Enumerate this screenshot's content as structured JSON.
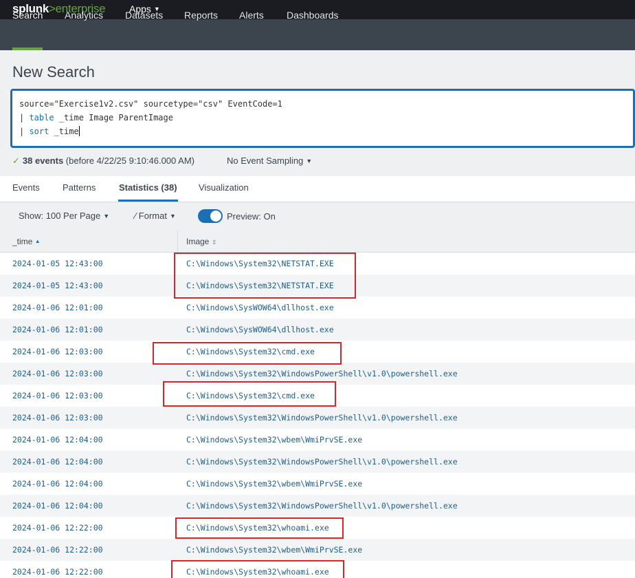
{
  "topbar": {
    "logo_word": "splunk",
    "logo_sep": ">",
    "logo_product": "enterprise",
    "apps_label": "Apps"
  },
  "nav": {
    "items": [
      {
        "label": "Search"
      },
      {
        "label": "Analytics"
      },
      {
        "label": "Datasets"
      },
      {
        "label": "Reports"
      },
      {
        "label": "Alerts"
      },
      {
        "label": "Dashboards"
      }
    ]
  },
  "search": {
    "page_title": "New Search",
    "query_line1": "source=\"Exercise1v2.csv\" sourcetype=\"csv\" EventCode=1",
    "query_line2_pipe": "| ",
    "query_line2_cmd": "table",
    "query_line2_args": " _time Image ParentImage",
    "query_line3_pipe": "| ",
    "query_line3_cmd": "sort",
    "query_line3_args": " _time",
    "event_count": "38 events",
    "event_detail": "(before 4/22/25 9:10:46.000 AM)",
    "sampling_label": "No Event Sampling"
  },
  "tabs": [
    {
      "label": "Events"
    },
    {
      "label": "Patterns"
    },
    {
      "label": "Statistics (38)"
    },
    {
      "label": "Visualization"
    }
  ],
  "toolbar": {
    "show_label": "Show: 100 Per Page",
    "format_label": "Format",
    "preview_label": "Preview: On"
  },
  "table": {
    "columns": [
      "_time",
      "Image"
    ],
    "rows": [
      {
        "time": "2024-01-05 12:43:00",
        "image": "C:\\Windows\\System32\\NETSTAT.EXE"
      },
      {
        "time": "2024-01-05 12:43:00",
        "image": "C:\\Windows\\System32\\NETSTAT.EXE"
      },
      {
        "time": "2024-01-06 12:01:00",
        "image": "C:\\Windows\\SysWOW64\\dllhost.exe"
      },
      {
        "time": "2024-01-06 12:01:00",
        "image": "C:\\Windows\\SysWOW64\\dllhost.exe"
      },
      {
        "time": "2024-01-06 12:03:00",
        "image": "C:\\Windows\\System32\\cmd.exe"
      },
      {
        "time": "2024-01-06 12:03:00",
        "image": "C:\\Windows\\System32\\WindowsPowerShell\\v1.0\\powershell.exe"
      },
      {
        "time": "2024-01-06 12:03:00",
        "image": "C:\\Windows\\System32\\cmd.exe"
      },
      {
        "time": "2024-01-06 12:03:00",
        "image": "C:\\Windows\\System32\\WindowsPowerShell\\v1.0\\powershell.exe"
      },
      {
        "time": "2024-01-06 12:04:00",
        "image": "C:\\Windows\\System32\\wbem\\WmiPrvSE.exe"
      },
      {
        "time": "2024-01-06 12:04:00",
        "image": "C:\\Windows\\System32\\WindowsPowerShell\\v1.0\\powershell.exe"
      },
      {
        "time": "2024-01-06 12:04:00",
        "image": "C:\\Windows\\System32\\wbem\\WmiPrvSE.exe"
      },
      {
        "time": "2024-01-06 12:04:00",
        "image": "C:\\Windows\\System32\\WindowsPowerShell\\v1.0\\powershell.exe"
      },
      {
        "time": "2024-01-06 12:22:00",
        "image": "C:\\Windows\\System32\\whoami.exe"
      },
      {
        "time": "2024-01-06 12:22:00",
        "image": "C:\\Windows\\System32\\wbem\\WmiPrvSE.exe"
      },
      {
        "time": "2024-01-06 12:22:00",
        "image": "C:\\Windows\\System32\\whoami.exe"
      }
    ]
  },
  "colors": {
    "accent": "#65a637",
    "link": "#1e5c8f",
    "highlight_box": "#d9252a",
    "search_border": "#1a6fb5"
  }
}
